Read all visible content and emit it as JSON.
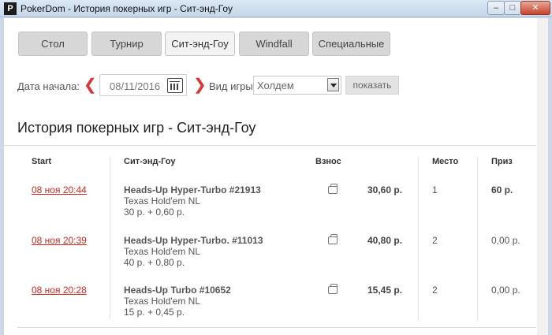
{
  "window": {
    "title": "PokerDom - История покерных игр - Сит-энд-Гоу",
    "icon": "P"
  },
  "tabs": [
    {
      "label": "Стол",
      "active": false
    },
    {
      "label": "Турнир",
      "active": false
    },
    {
      "label": "Сит-энд-Гоу",
      "active": true
    },
    {
      "label": "Windfall",
      "active": false
    },
    {
      "label": "Специальные",
      "active": false
    }
  ],
  "filters": {
    "start_date_label": "Дата начала:",
    "start_date_value": "08/11/2016",
    "game_type_label": "Вид игры:",
    "game_type_value": "Холдем",
    "show_button": "показать"
  },
  "page_title": "История покерных игр - Сит-энд-Гоу",
  "table": {
    "headers": {
      "start": "Start",
      "game": "Сит-энд-Гоу",
      "buyin": "Взнос",
      "place": "Место",
      "prize": "Приз"
    },
    "rows": [
      {
        "start": "08 ноя 20:44",
        "name": "Heads-Up Hyper-Turbo #21913",
        "variant": "Texas Hold'em NL",
        "fee": "30 р. + 0,60 р.",
        "buyin": "30,60 р.",
        "place": "1",
        "prize": "60 р.",
        "prize_bold": true
      },
      {
        "start": "08 ноя 20:39",
        "name": "Heads-Up Hyper-Turbo. #11013",
        "variant": "Texas Hold'em NL",
        "fee": "40 р. + 0,80 р.",
        "buyin": "40,80 р.",
        "place": "2",
        "prize": "0,00 р.",
        "prize_bold": false
      },
      {
        "start": "08 ноя 20:28",
        "name": "Heads-Up Turbo #10652",
        "variant": "Texas Hold'em NL",
        "fee": "15 р. + 0,45 р.",
        "buyin": "15,45 р.",
        "place": "2",
        "prize": "0,00 р.",
        "prize_bold": false
      }
    ]
  },
  "colors": {
    "accent_red": "#d0281e",
    "tab_bg": "#d7d7d7",
    "tab_active_bg": "#f3f3f3"
  }
}
